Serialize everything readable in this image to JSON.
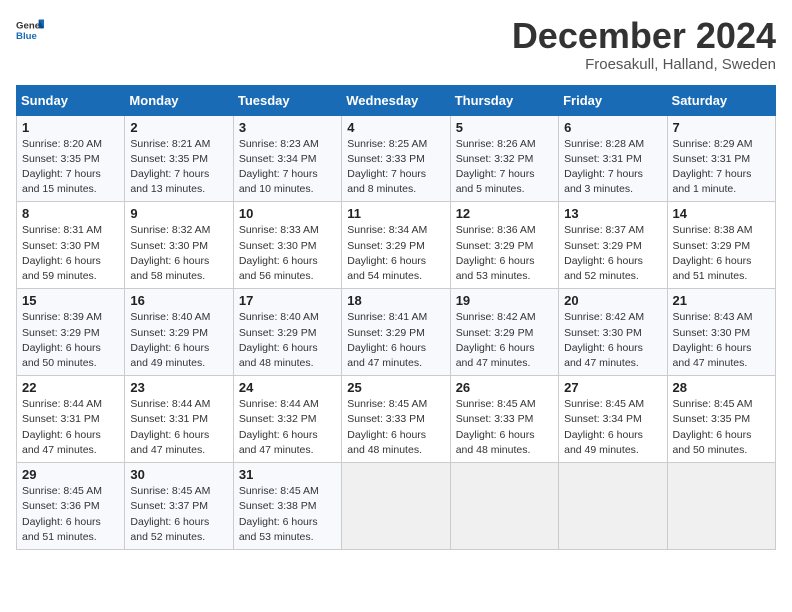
{
  "header": {
    "logo_general": "General",
    "logo_blue": "Blue",
    "month_title": "December 2024",
    "subtitle": "Froesakull, Halland, Sweden"
  },
  "days_of_week": [
    "Sunday",
    "Monday",
    "Tuesday",
    "Wednesday",
    "Thursday",
    "Friday",
    "Saturday"
  ],
  "weeks": [
    [
      {
        "day": "1",
        "sunrise": "8:20 AM",
        "sunset": "3:35 PM",
        "daylight": "7 hours and 15 minutes."
      },
      {
        "day": "2",
        "sunrise": "8:21 AM",
        "sunset": "3:35 PM",
        "daylight": "7 hours and 13 minutes."
      },
      {
        "day": "3",
        "sunrise": "8:23 AM",
        "sunset": "3:34 PM",
        "daylight": "7 hours and 10 minutes."
      },
      {
        "day": "4",
        "sunrise": "8:25 AM",
        "sunset": "3:33 PM",
        "daylight": "7 hours and 8 minutes."
      },
      {
        "day": "5",
        "sunrise": "8:26 AM",
        "sunset": "3:32 PM",
        "daylight": "7 hours and 5 minutes."
      },
      {
        "day": "6",
        "sunrise": "8:28 AM",
        "sunset": "3:31 PM",
        "daylight": "7 hours and 3 minutes."
      },
      {
        "day": "7",
        "sunrise": "8:29 AM",
        "sunset": "3:31 PM",
        "daylight": "7 hours and 1 minute."
      }
    ],
    [
      {
        "day": "8",
        "sunrise": "8:31 AM",
        "sunset": "3:30 PM",
        "daylight": "6 hours and 59 minutes."
      },
      {
        "day": "9",
        "sunrise": "8:32 AM",
        "sunset": "3:30 PM",
        "daylight": "6 hours and 58 minutes."
      },
      {
        "day": "10",
        "sunrise": "8:33 AM",
        "sunset": "3:30 PM",
        "daylight": "6 hours and 56 minutes."
      },
      {
        "day": "11",
        "sunrise": "8:34 AM",
        "sunset": "3:29 PM",
        "daylight": "6 hours and 54 minutes."
      },
      {
        "day": "12",
        "sunrise": "8:36 AM",
        "sunset": "3:29 PM",
        "daylight": "6 hours and 53 minutes."
      },
      {
        "day": "13",
        "sunrise": "8:37 AM",
        "sunset": "3:29 PM",
        "daylight": "6 hours and 52 minutes."
      },
      {
        "day": "14",
        "sunrise": "8:38 AM",
        "sunset": "3:29 PM",
        "daylight": "6 hours and 51 minutes."
      }
    ],
    [
      {
        "day": "15",
        "sunrise": "8:39 AM",
        "sunset": "3:29 PM",
        "daylight": "6 hours and 50 minutes."
      },
      {
        "day": "16",
        "sunrise": "8:40 AM",
        "sunset": "3:29 PM",
        "daylight": "6 hours and 49 minutes."
      },
      {
        "day": "17",
        "sunrise": "8:40 AM",
        "sunset": "3:29 PM",
        "daylight": "6 hours and 48 minutes."
      },
      {
        "day": "18",
        "sunrise": "8:41 AM",
        "sunset": "3:29 PM",
        "daylight": "6 hours and 47 minutes."
      },
      {
        "day": "19",
        "sunrise": "8:42 AM",
        "sunset": "3:29 PM",
        "daylight": "6 hours and 47 minutes."
      },
      {
        "day": "20",
        "sunrise": "8:42 AM",
        "sunset": "3:30 PM",
        "daylight": "6 hours and 47 minutes."
      },
      {
        "day": "21",
        "sunrise": "8:43 AM",
        "sunset": "3:30 PM",
        "daylight": "6 hours and 47 minutes."
      }
    ],
    [
      {
        "day": "22",
        "sunrise": "8:44 AM",
        "sunset": "3:31 PM",
        "daylight": "6 hours and 47 minutes."
      },
      {
        "day": "23",
        "sunrise": "8:44 AM",
        "sunset": "3:31 PM",
        "daylight": "6 hours and 47 minutes."
      },
      {
        "day": "24",
        "sunrise": "8:44 AM",
        "sunset": "3:32 PM",
        "daylight": "6 hours and 47 minutes."
      },
      {
        "day": "25",
        "sunrise": "8:45 AM",
        "sunset": "3:33 PM",
        "daylight": "6 hours and 48 minutes."
      },
      {
        "day": "26",
        "sunrise": "8:45 AM",
        "sunset": "3:33 PM",
        "daylight": "6 hours and 48 minutes."
      },
      {
        "day": "27",
        "sunrise": "8:45 AM",
        "sunset": "3:34 PM",
        "daylight": "6 hours and 49 minutes."
      },
      {
        "day": "28",
        "sunrise": "8:45 AM",
        "sunset": "3:35 PM",
        "daylight": "6 hours and 50 minutes."
      }
    ],
    [
      {
        "day": "29",
        "sunrise": "8:45 AM",
        "sunset": "3:36 PM",
        "daylight": "6 hours and 51 minutes."
      },
      {
        "day": "30",
        "sunrise": "8:45 AM",
        "sunset": "3:37 PM",
        "daylight": "6 hours and 52 minutes."
      },
      {
        "day": "31",
        "sunrise": "8:45 AM",
        "sunset": "3:38 PM",
        "daylight": "6 hours and 53 minutes."
      },
      null,
      null,
      null,
      null
    ]
  ]
}
